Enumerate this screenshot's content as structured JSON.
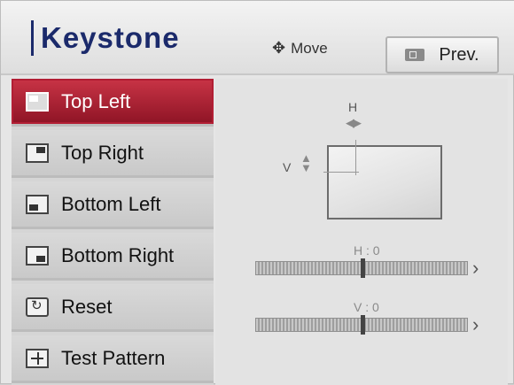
{
  "header": {
    "title": "Keystone",
    "move_label": "Move",
    "move_icon": "move-arrows-icon",
    "prev_label": "Prev."
  },
  "menu": {
    "items": [
      {
        "label": "Top Left",
        "icon": "top-left-icon",
        "active": true
      },
      {
        "label": "Top Right",
        "icon": "top-right-icon",
        "active": false
      },
      {
        "label": "Bottom Left",
        "icon": "bottom-left-icon",
        "active": false
      },
      {
        "label": "Bottom Right",
        "icon": "bottom-right-icon",
        "active": false
      },
      {
        "label": "Reset",
        "icon": "reset-icon",
        "active": false
      },
      {
        "label": "Test Pattern",
        "icon": "test-pattern-icon",
        "active": false
      }
    ]
  },
  "preview": {
    "h_label": "H",
    "v_label": "V",
    "h_slider_label": "H : 0",
    "v_slider_label": "V : 0",
    "h_value": 0,
    "v_value": 0
  },
  "colors": {
    "active_item": "#b21e34",
    "title": "#1b2a6b"
  }
}
